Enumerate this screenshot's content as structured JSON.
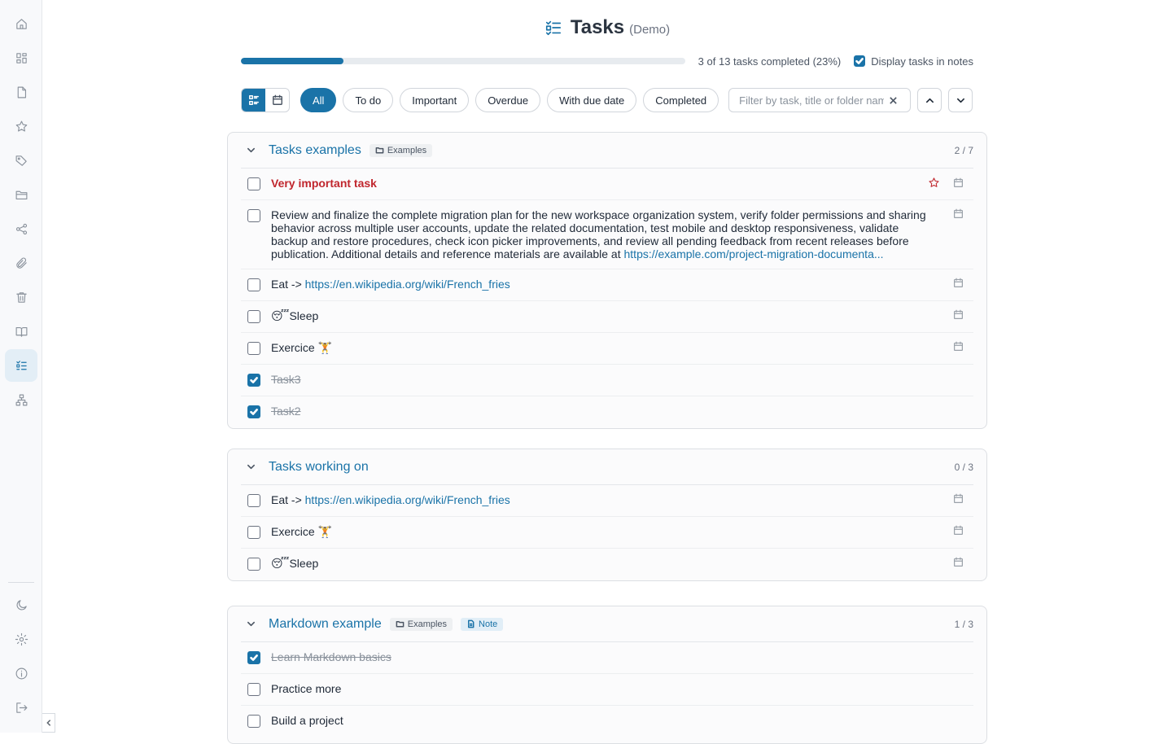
{
  "header": {
    "title": "Tasks",
    "subtitle": "(Demo)"
  },
  "progress": {
    "fraction": 0.23,
    "text": "3 of 13 tasks completed (23%)"
  },
  "display_toggle": {
    "label": "Display tasks in notes",
    "checked": true
  },
  "filters": [
    {
      "label": "All",
      "active": true
    },
    {
      "label": "To do",
      "active": false
    },
    {
      "label": "Important",
      "active": false
    },
    {
      "label": "Overdue",
      "active": false
    },
    {
      "label": "With due date",
      "active": false
    },
    {
      "label": "Completed",
      "active": false
    }
  ],
  "search": {
    "placeholder": "Filter by task, title or folder name",
    "value": ""
  },
  "sidebar": {
    "items": [
      "home-icon",
      "dashboard-icon",
      "note-icon",
      "star-icon",
      "tag-icon",
      "folder-icon",
      "share-icon",
      "attachment-icon",
      "trash-icon",
      "book-icon",
      "tasks-icon",
      "hierarchy-icon"
    ],
    "bottom": [
      "moon-icon",
      "settings-icon",
      "info-icon",
      "logout-icon"
    ],
    "active": "tasks-icon"
  },
  "cards": [
    {
      "title": "Tasks examples",
      "folder": "Examples",
      "note": "",
      "count": "2 / 7",
      "tasks": [
        {
          "text": "Very important task",
          "important": true,
          "done": false
        },
        {
          "text": "Review and finalize the complete migration plan for the new workspace organization system, verify folder permissions and sharing behavior across multiple user accounts, update the related documentation, test mobile and desktop responsiveness, validate backup and restore procedures, check icon picker improvements, and review all pending feedback from recent releases before publication. Additional details and reference materials are available at ",
          "link": "https://example.com/project-migration-documenta...",
          "done": false
        },
        {
          "text": "Eat -> ",
          "link": "https://en.wikipedia.org/wiki/French_fries",
          "done": false
        },
        {
          "text": "😴Sleep",
          "done": false
        },
        {
          "text": "Exercice 🏋",
          "done": false
        },
        {
          "text": "Task3",
          "done": true
        },
        {
          "text": "Task2",
          "done": true
        }
      ]
    },
    {
      "title": "Tasks working on",
      "folder": "",
      "note": "",
      "count": "0 / 3",
      "tasks": [
        {
          "text": "Eat -> ",
          "link": "https://en.wikipedia.org/wiki/French_fries",
          "done": false
        },
        {
          "text": "Exercice 🏋",
          "done": false
        },
        {
          "text": "😴Sleep",
          "done": false
        }
      ]
    },
    {
      "title": "Markdown example",
      "folder": "Examples",
      "note": "Note",
      "count": "1 / 3",
      "tasks": [
        {
          "text": "Learn Markdown basics",
          "done": true
        },
        {
          "text": "Practice more",
          "done": false
        },
        {
          "text": "Build a project",
          "done": false
        }
      ]
    }
  ],
  "colors": {
    "accent": "#1a73a8",
    "important": "#c0262d",
    "card_bg": "#fbfbfc",
    "sidebar_bg": "#f8f9fb"
  }
}
